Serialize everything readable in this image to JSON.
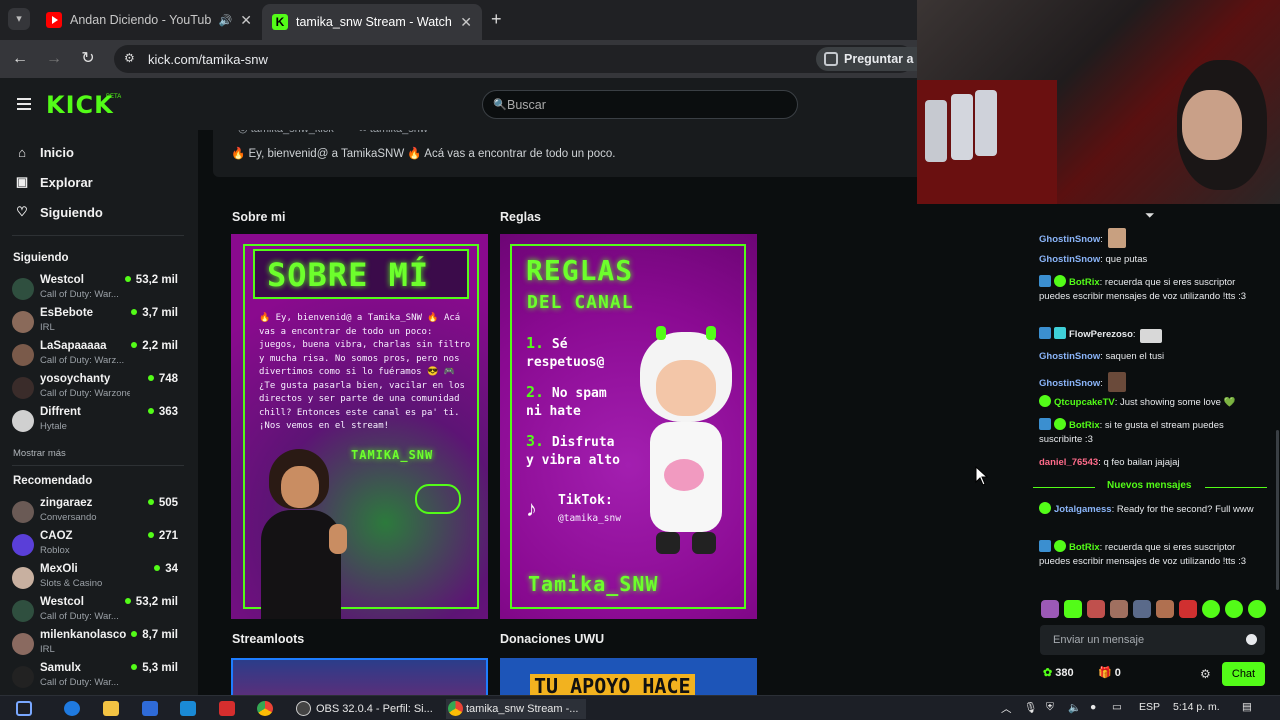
{
  "browser": {
    "tabs": [
      {
        "title": "Andan Diciendo - YouTube",
        "favicon": "youtube-icon"
      },
      {
        "title": "tamika_snw Stream - Watch Liv",
        "favicon": "kick-icon"
      }
    ],
    "url": "kick.com/tamika-snw",
    "ask_label": "Preguntar a C"
  },
  "header": {
    "logo": "KICK",
    "beta": "BETA",
    "search_placeholder": "Buscar"
  },
  "sidebar": {
    "nav": [
      {
        "label": "Inicio",
        "icon": "home-icon"
      },
      {
        "label": "Explorar",
        "icon": "browse-icon"
      },
      {
        "label": "Siguiendo",
        "icon": "heart-icon"
      }
    ],
    "following_title": "Siguiendo",
    "following": [
      {
        "name": "Westcol",
        "category": "Call of Duty: War...",
        "viewers": "53,2 mil"
      },
      {
        "name": "EsBebote",
        "category": "IRL",
        "viewers": "3,7 mil"
      },
      {
        "name": "LaSapaaaaa",
        "category": "Call of Duty: Warz...",
        "viewers": "2,2 mil"
      },
      {
        "name": "yosoychanty",
        "category": "Call of Duty: Warzone",
        "viewers": "748"
      },
      {
        "name": "Diffrent",
        "category": "Hytale",
        "viewers": "363"
      }
    ],
    "show_more": "Mostrar más",
    "recommended_title": "Recomendado",
    "recommended": [
      {
        "name": "zingaraez",
        "category": "Conversando",
        "viewers": "505"
      },
      {
        "name": "CAOZ",
        "category": "Roblox",
        "viewers": "271"
      },
      {
        "name": "MexOli",
        "category": "Slots & Casino",
        "viewers": "34"
      },
      {
        "name": "Westcol",
        "category": "Call of Duty: War...",
        "viewers": "53,2 mil"
      },
      {
        "name": "milenkanolasco",
        "category": "IRL",
        "viewers": "8,7 mil"
      },
      {
        "name": "Samulx",
        "category": "Call of Duty: War...",
        "viewers": "5,3 mil"
      }
    ]
  },
  "main": {
    "socials": [
      "tamika_snw_kick",
      "tamika_snw"
    ],
    "bio": "🔥 Ey, bienvenid@ a TamikaSNW 🔥 Acá vas a encontrar de todo un poco.",
    "panels": [
      {
        "heading": "Sobre mi",
        "title": "SOBRE MÍ",
        "body": "🔥 Ey, bienvenid@ a Tamika_SNW 🔥 Acá vas a encontrar de todo un poco: juegos, buena vibra, charlas sin filtro y mucha risa. No somos pros, pero nos divertimos como si lo fuéramos 😎 🎮 ¿Te gusta pasarla bien, vacilar en los directos y ser parte de una comunidad chill? Entonces este canal es pa' ti. ¡Nos vemos en el stream!",
        "signature": "TAMIKA_SNW"
      },
      {
        "heading": "Reglas",
        "title": "REGLAS",
        "subtitle": "DEL CANAL",
        "rules": [
          {
            "n": "1.",
            "text": "Sé respetuos@"
          },
          {
            "n": "2.",
            "text": "No spam ni hate"
          },
          {
            "n": "3.",
            "text": "Disfruta y vibra alto"
          }
        ],
        "tiktok_label": "TikTok:",
        "tiktok_handle": "@tamika_snw",
        "signature": "Tamika_SNW"
      }
    ],
    "lower_headings": [
      "Streamloots",
      "Donaciones UWU"
    ],
    "donation_banner": "TU APOYO HACE"
  },
  "chat": {
    "messages": [
      {
        "user": "GhostinSnow",
        "color": "#8ab4f8",
        "text": "",
        "emote": true,
        "badges": []
      },
      {
        "user": "GhostinSnow",
        "color": "#8ab4f8",
        "text": "que putas",
        "badges": []
      },
      {
        "user": "BotRix",
        "color": "#53fc18",
        "text": "recuerda que si eres suscriptor puedes escribir mensajes de voz utilizando !tts :3",
        "badges": [
          "mod",
          "verified"
        ]
      },
      {
        "user": "FlowPerezoso",
        "color": "#e8eaed",
        "text": "",
        "emote": true,
        "badges": [
          "mod",
          "sub"
        ]
      },
      {
        "user": "GhostinSnow",
        "color": "#8ab4f8",
        "text": "saquen el tusi",
        "badges": []
      },
      {
        "user": "GhostinSnow",
        "color": "#8ab4f8",
        "text": "",
        "emote": true,
        "badges": []
      },
      {
        "user": "QtcupcakeTV",
        "color": "#53fc18",
        "text": "Just showing some love 💚",
        "badges": [
          "verified"
        ]
      },
      {
        "user": "BotRix",
        "color": "#53fc18",
        "text": "si te gusta el stream puedes suscribirte :3",
        "badges": [
          "mod",
          "verified"
        ]
      },
      {
        "user": "daniel_76543",
        "color": "#ff6b8a",
        "text": "q feo bailan jajajaj",
        "badges": []
      }
    ],
    "new_messages": "Nuevos mensajes",
    "new": [
      {
        "user": "Jotalgamess",
        "color": "#8ab4f8",
        "text": "Ready for the second? Full www",
        "badges": [
          "verified"
        ]
      },
      {
        "user": "BotRix",
        "color": "#53fc18",
        "text": "recuerda que si eres suscriptor puedes escribir mensajes de voz utilizando !tts :3",
        "badges": [
          "mod",
          "verified"
        ]
      }
    ],
    "input_placeholder": "Enviar un mensaje",
    "points": "380",
    "gifts": "0",
    "chat_button": "Chat"
  },
  "taskbar": {
    "apps": [
      {
        "label": "OBS 32.0.4 - Perfil: Si..."
      },
      {
        "label": "tamika_snw Stream -..."
      }
    ],
    "lang": "ESP",
    "time": "5:14 p. m."
  }
}
